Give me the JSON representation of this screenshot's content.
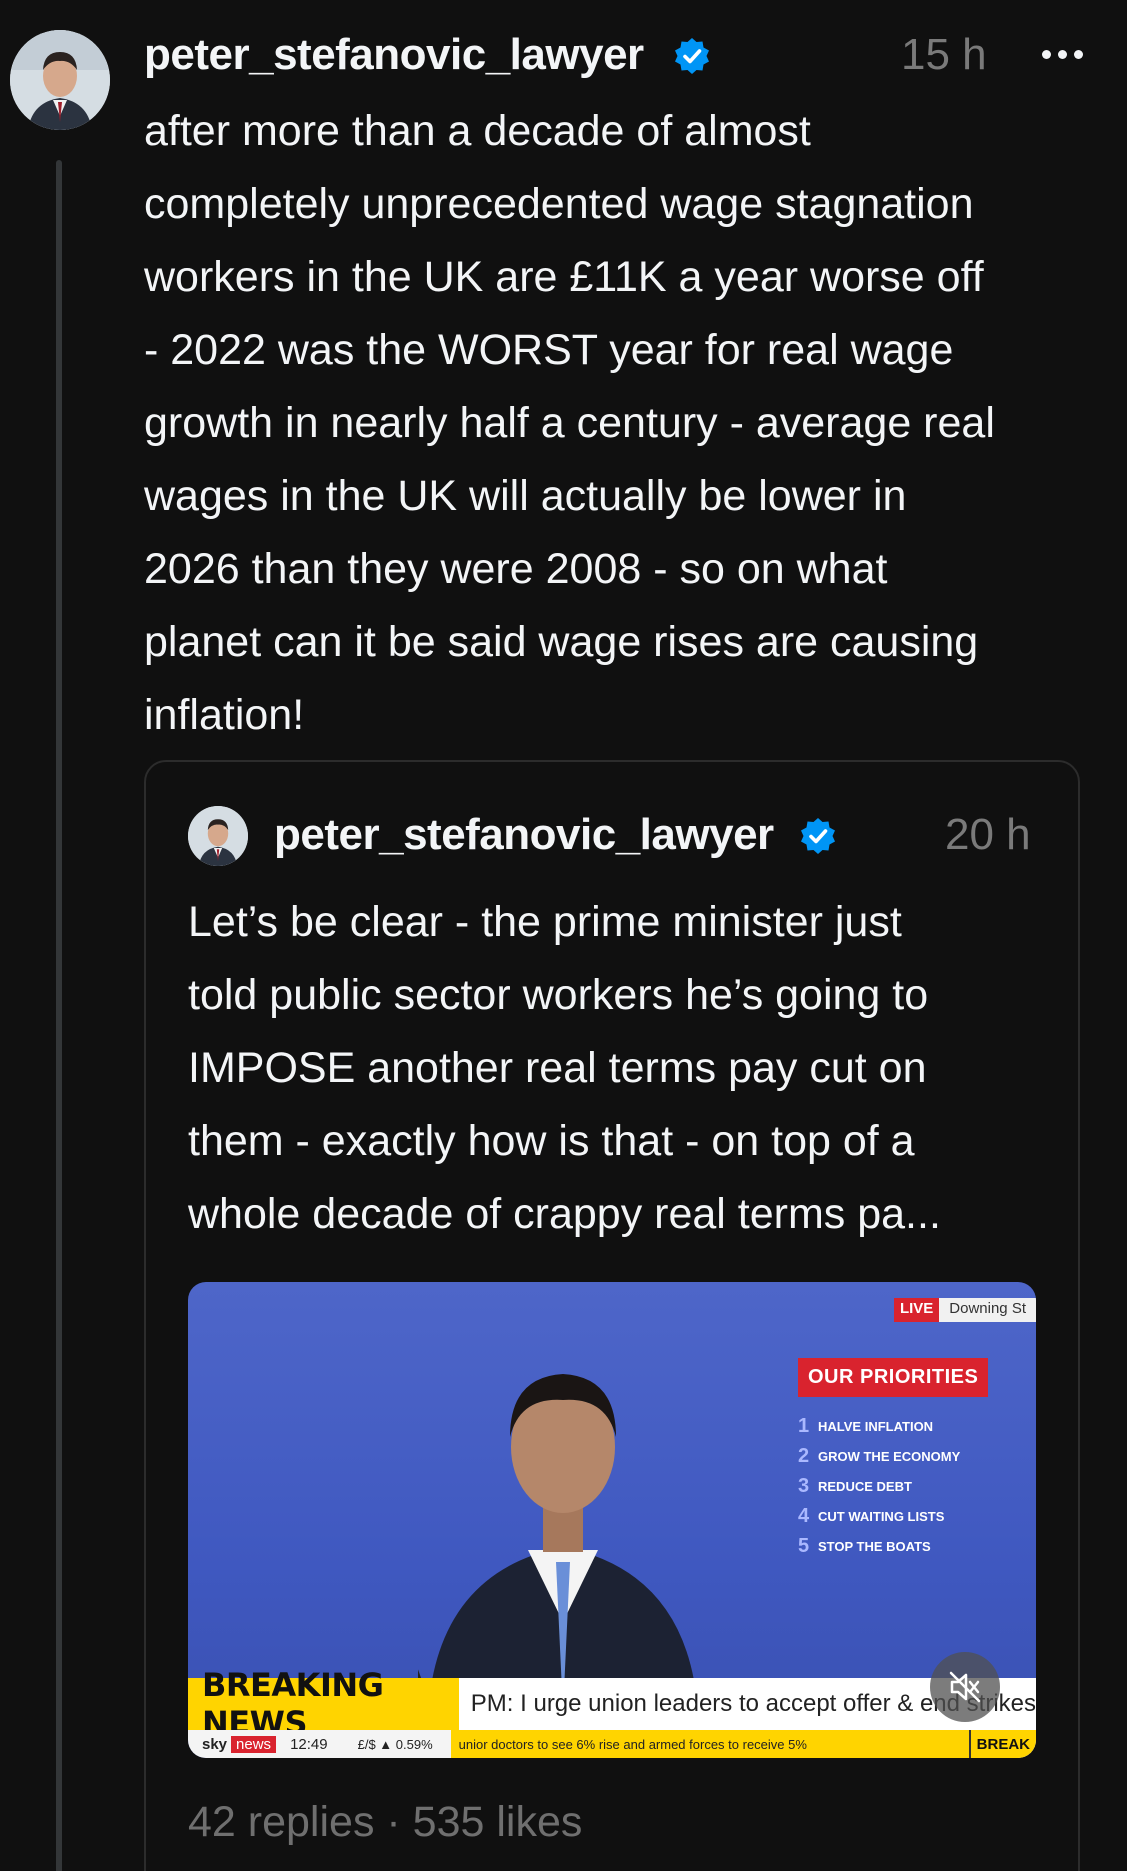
{
  "post": {
    "username": "peter_stefanovic_lawyer",
    "timestamp": "15 h",
    "text": "after more than a decade of almost\ncompletely unprecedented wage stagnation\nworkers in the UK are £11K a year worse off\n- 2022 was the WORST year for real wage\ngrowth in nearly half a century - average real\nwages in the UK will actually be lower in\n2026 than they were 2008 - so on what\nplanet can it be said wage rises are causing\ninflation!"
  },
  "quoted": {
    "username": "peter_stefanovic_lawyer",
    "timestamp": "20 h",
    "text": "Let’s be clear - the prime minister just\ntold public sector workers he’s going to\nIMPOSE another real terms pay cut on\nthem - exactly how is that - on top of a\nwhole decade of crappy real terms pa...",
    "stats": "42 replies · 535 likes",
    "video": {
      "live_label": "LIVE",
      "location": "Downing St",
      "priorities_title": "OUR PRIORITIES",
      "priorities": [
        {
          "num": "1",
          "label": "HALVE INFLATION"
        },
        {
          "num": "2",
          "label": "GROW THE ECONOMY"
        },
        {
          "num": "3",
          "label": "REDUCE DEBT"
        },
        {
          "num": "4",
          "label": "CUT WAITING LISTS"
        },
        {
          "num": "5",
          "label": "STOP THE BOATS"
        }
      ],
      "breaking_label": "BREAKING NEWS",
      "headline": "PM: I urge union leaders to accept offer & end strikes",
      "channel_sky": "sky",
      "channel_news": "news",
      "clock": "12:49",
      "fx": "£/$ ▲ 0.59%",
      "crawl": "unior doctors to see 6% rise and armed forces to receive 5%",
      "ticker_break": "BREAK"
    }
  },
  "colors": {
    "background": "#101010",
    "text": "#f3f5f7",
    "muted": "#7a7a7a",
    "verified": "#0095f6"
  },
  "icons": {
    "verified": "verified-badge-icon",
    "more": "more-horizontal-icon",
    "mute": "speaker-muted-icon"
  }
}
